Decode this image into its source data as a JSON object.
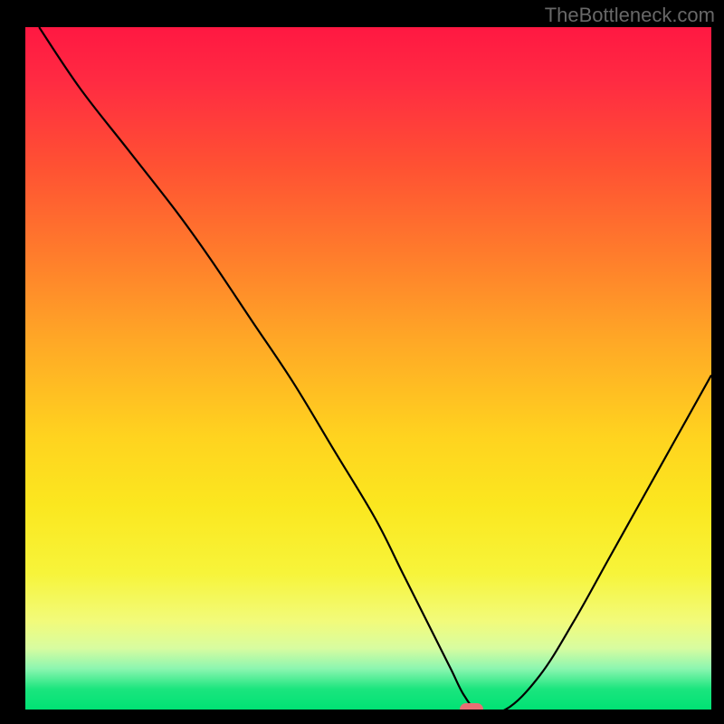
{
  "watermark": "TheBottleneck.com",
  "chart_data": {
    "type": "line",
    "title": "",
    "xlabel": "",
    "ylabel": "",
    "xlim": [
      0,
      100
    ],
    "ylim": [
      0,
      100
    ],
    "series": [
      {
        "name": "bottleneck-curve",
        "x": [
          2,
          8,
          15,
          22,
          27,
          33,
          39,
          45,
          51,
          55,
          59,
          62,
          64,
          66,
          70,
          75,
          80,
          85,
          90,
          95,
          100
        ],
        "y": [
          100,
          91,
          82,
          73,
          66,
          57,
          48,
          38,
          28,
          20,
          12,
          6,
          2,
          0,
          0,
          5,
          13,
          22,
          31,
          40,
          49
        ]
      }
    ],
    "marker": {
      "x": 65,
      "y": 0,
      "color": "#e96f74"
    },
    "background": "red-yellow-green vertical gradient",
    "grid": false,
    "legend": false
  }
}
